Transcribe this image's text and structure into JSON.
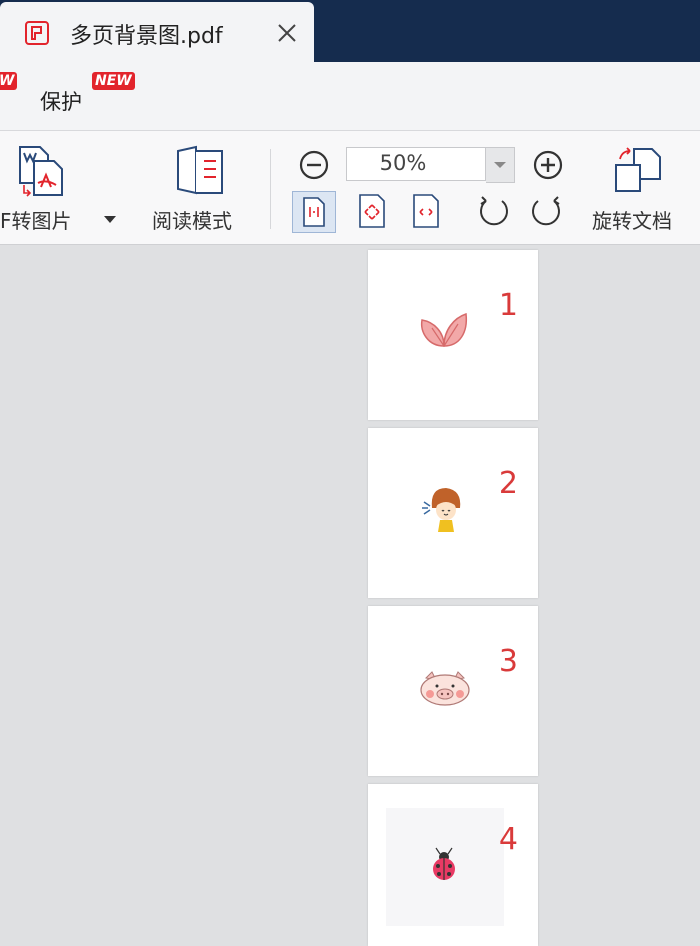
{
  "tab": {
    "title": "多页背景图.pdf",
    "icon": "pdf-app-icon",
    "close_icon": "close-icon"
  },
  "menubar": {
    "protect_label": "保护",
    "new_badge": "NEW",
    "partial_badge": "W"
  },
  "toolbar": {
    "pdf_to_image_label": "F转图片",
    "read_mode_label": "阅读模式",
    "rotate_doc_label": "旋转文档",
    "zoom_value": "50%"
  },
  "pages": [
    {
      "number": "1",
      "art": "leaf-sprout"
    },
    {
      "number": "2",
      "art": "cartoon-girl"
    },
    {
      "number": "3",
      "art": "pig-face"
    },
    {
      "number": "4",
      "art": "ladybug"
    }
  ],
  "colors": {
    "titlebar": "#152c4e",
    "accent_red": "#e2242c",
    "page_number": "#d93a3a",
    "canvas": "#dfe0e2"
  }
}
